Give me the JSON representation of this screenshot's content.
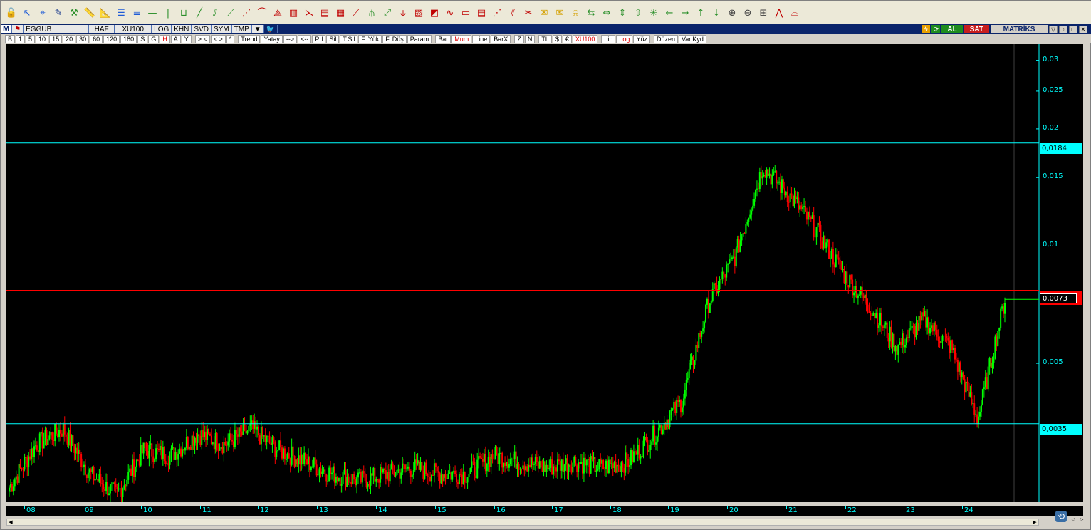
{
  "tools": [
    {
      "name": "lock-icon",
      "glyph": "🔓",
      "color": "#2a8f2a"
    },
    {
      "name": "cursor-arrow-icon",
      "glyph": "↖",
      "color": "#1e5bd6"
    },
    {
      "name": "crosshair-icon",
      "glyph": "⌖",
      "color": "#1e5bd6"
    },
    {
      "name": "pencil-icon",
      "glyph": "✎",
      "color": "#1e3e8f"
    },
    {
      "name": "tools-icon",
      "glyph": "⚒",
      "color": "#2a8f2a"
    },
    {
      "name": "ruler-icon",
      "glyph": "📏",
      "color": "#2a8f2a"
    },
    {
      "name": "ruler-alt-icon",
      "glyph": "📐",
      "color": "#2a8f2a"
    },
    {
      "name": "parallel-lines-icon",
      "glyph": "☰",
      "color": "#1e5bd6"
    },
    {
      "name": "equal-lines-icon",
      "glyph": "≡",
      "color": "#1e5bd6"
    },
    {
      "name": "horizontal-line-icon",
      "glyph": "—",
      "color": "#2a8f2a"
    },
    {
      "name": "vertical-line-icon",
      "glyph": "|",
      "color": "#2a8f2a"
    },
    {
      "name": "channel-icon",
      "glyph": "⊔",
      "color": "#2a8f2a"
    },
    {
      "name": "trend-line-icon",
      "glyph": "╱",
      "color": "#2a8f2a"
    },
    {
      "name": "trend-channel-icon",
      "glyph": "⫽",
      "color": "#2a8f2a"
    },
    {
      "name": "regression-icon",
      "glyph": "⟋",
      "color": "#2a8f2a"
    },
    {
      "name": "fibonacci-fan-icon",
      "glyph": "⋰",
      "color": "#c00000"
    },
    {
      "name": "fibonacci-arc-icon",
      "glyph": "⌒",
      "color": "#c00000"
    },
    {
      "name": "gann-fan-icon",
      "glyph": "⟁",
      "color": "#c00000"
    },
    {
      "name": "bars-pattern-icon",
      "glyph": "▥",
      "color": "#c00000"
    },
    {
      "name": "fan-lines-icon",
      "glyph": "⋋",
      "color": "#c00000"
    },
    {
      "name": "fibonacci-retracement-icon",
      "glyph": "▤",
      "color": "#c00000"
    },
    {
      "name": "fibonacci-extension-icon",
      "glyph": "▦",
      "color": "#c00000"
    },
    {
      "name": "speed-lines-icon",
      "glyph": "⟋",
      "color": "#c00000"
    },
    {
      "name": "andrews-pitchfork-icon",
      "glyph": "⫛",
      "color": "#2a8f2a"
    },
    {
      "name": "diagonal-brush-icon",
      "glyph": "⤢",
      "color": "#2a8f2a"
    },
    {
      "name": "cycle-lines-icon",
      "glyph": "⫝",
      "color": "#c00000"
    },
    {
      "name": "time-zones-icon",
      "glyph": "▧",
      "color": "#c00000"
    },
    {
      "name": "raff-channel-icon",
      "glyph": "◩",
      "color": "#c00000"
    },
    {
      "name": "elliott-wave-icon",
      "glyph": "∿",
      "color": "#c00000"
    },
    {
      "name": "fibonacci-time-icon",
      "glyph": "▭",
      "color": "#c00000"
    },
    {
      "name": "grid-lines-icon",
      "glyph": "▤",
      "color": "#c00000"
    },
    {
      "name": "dashed-line-icon",
      "glyph": "⋰",
      "color": "#c00000"
    },
    {
      "name": "ruler-measure-icon",
      "glyph": "⫽",
      "color": "#c00000"
    },
    {
      "name": "paint-icon",
      "glyph": "✂",
      "color": "#c00000"
    },
    {
      "name": "note-icon",
      "glyph": "✉",
      "color": "#d4a000"
    },
    {
      "name": "callout-icon",
      "glyph": "✉",
      "color": "#d4a000"
    },
    {
      "name": "alarm-bell-icon",
      "glyph": "⍾",
      "color": "#d4a000"
    },
    {
      "name": "zoom-in-horizontal-icon",
      "glyph": "⇆",
      "color": "#2a8f2a"
    },
    {
      "name": "zoom-out-horizontal-icon",
      "glyph": "⇔",
      "color": "#2a8f2a"
    },
    {
      "name": "zoom-in-vertical-icon",
      "glyph": "⇕",
      "color": "#2a8f2a"
    },
    {
      "name": "zoom-out-vertical-icon",
      "glyph": "⇳",
      "color": "#2a8f2a"
    },
    {
      "name": "fit-all-icon",
      "glyph": "✳",
      "color": "#2a8f2a"
    },
    {
      "name": "arrow-left-icon",
      "glyph": "←",
      "color": "#2a8f2a"
    },
    {
      "name": "arrow-right-icon",
      "glyph": "→",
      "color": "#2a8f2a"
    },
    {
      "name": "arrow-up-icon",
      "glyph": "↑",
      "color": "#2a8f2a"
    },
    {
      "name": "arrow-down-icon",
      "glyph": "↓",
      "color": "#2a8f2a"
    },
    {
      "name": "magnifier-add-icon",
      "glyph": "⊕",
      "color": "#404040"
    },
    {
      "name": "magnifier-remove-icon",
      "glyph": "⊖",
      "color": "#404040"
    },
    {
      "name": "chart-settings-icon",
      "glyph": "⊞",
      "color": "#404040"
    },
    {
      "name": "line-chart-icon",
      "glyph": "⋀",
      "color": "#c00000"
    },
    {
      "name": "arc-icon",
      "glyph": "⌓",
      "color": "#c00000"
    }
  ],
  "infobar": {
    "menu": "M",
    "symbol": "EGGUB",
    "period": "HAF",
    "index": "XU100",
    "log": "LOG",
    "khn": "KHN",
    "svd": "SVD",
    "sym": "SYM",
    "tmp": "TMP",
    "buy_label": "AL",
    "sell_label": "SAT",
    "brand": "MATRİKS"
  },
  "optbar": {
    "periods": [
      "B",
      "1",
      "5",
      "10",
      "15",
      "20",
      "30",
      "60",
      "120",
      "180",
      "S",
      "G",
      "H",
      "A",
      "Y"
    ],
    "selected_period": "H",
    "scroll": [
      ">.<",
      "<.>",
      "*"
    ],
    "drawing": [
      "Trend",
      "Yatay",
      "-->",
      "<--",
      "Prl",
      "Sil",
      "T.Sil",
      "F. Yük",
      "F. Düş",
      "Param"
    ],
    "chart_types": [
      "Bar",
      "Mum",
      "Line",
      "BarX"
    ],
    "selected_chart_type": "Mum",
    "scale": [
      "Z",
      "N"
    ],
    "currency": [
      "TL",
      "$",
      "€",
      "XU100"
    ],
    "selected_currency": "XU100",
    "axis": [
      "Lin",
      "Log",
      "Yüz"
    ],
    "selected_axis": "Log",
    "edit": [
      "Düzen",
      "Var.Kyd"
    ]
  },
  "chart_data": {
    "type": "candlestick",
    "symbol": "EGGUB",
    "scale": "log",
    "ylim": [
      0.0022,
      0.033
    ],
    "y_ticks": [
      "0,03",
      "0,025",
      "0,02",
      "0,015",
      "0,01",
      "0,005"
    ],
    "y_tick_values": [
      0.03,
      0.025,
      0.02,
      0.015,
      0.01,
      0.005
    ],
    "x_labels": [
      "08",
      "09",
      "10",
      "11",
      "12",
      "13",
      "14",
      "15",
      "16",
      "17",
      "18",
      "19",
      "20",
      "21",
      "22",
      "23",
      "24"
    ],
    "horizontal_lines": [
      {
        "value": 0.0184,
        "label": "0,0184",
        "color": "#00ffff"
      },
      {
        "value": 0.0035,
        "label": "0,0035",
        "color": "#00ffff"
      },
      {
        "value": 0.0077,
        "label": "",
        "color": "#ff0000"
      }
    ],
    "last_price": {
      "value": 0.0073,
      "label": "0,0073"
    },
    "up_color": "#00ff00",
    "down_color": "#ff0000",
    "price_path": [
      {
        "year": "08",
        "price": 0.0024
      },
      {
        "year": "08",
        "price": 0.0031
      },
      {
        "year": "08",
        "price": 0.0034
      },
      {
        "year": "09",
        "price": 0.0026
      },
      {
        "year": "09",
        "price": 0.0023
      },
      {
        "year": "10",
        "price": 0.003
      },
      {
        "year": "10",
        "price": 0.0029
      },
      {
        "year": "11",
        "price": 0.0033
      },
      {
        "year": "11",
        "price": 0.0031
      },
      {
        "year": "12",
        "price": 0.0034
      },
      {
        "year": "12",
        "price": 0.003
      },
      {
        "year": "13",
        "price": 0.0028
      },
      {
        "year": "13",
        "price": 0.0026
      },
      {
        "year": "14",
        "price": 0.0025
      },
      {
        "year": "14",
        "price": 0.0026
      },
      {
        "year": "15",
        "price": 0.0027
      },
      {
        "year": "15",
        "price": 0.0026
      },
      {
        "year": "16",
        "price": 0.0026
      },
      {
        "year": "16",
        "price": 0.0029
      },
      {
        "year": "17",
        "price": 0.0028
      },
      {
        "year": "17",
        "price": 0.0027
      },
      {
        "year": "18",
        "price": 0.0028
      },
      {
        "year": "18",
        "price": 0.0027
      },
      {
        "year": "19",
        "price": 0.0028
      },
      {
        "year": "19",
        "price": 0.0033
      },
      {
        "year": "20",
        "price": 0.004
      },
      {
        "year": "20",
        "price": 0.0072
      },
      {
        "year": "21",
        "price": 0.0095
      },
      {
        "year": "21",
        "price": 0.016
      },
      {
        "year": "21",
        "price": 0.0135
      },
      {
        "year": "22",
        "price": 0.011
      },
      {
        "year": "22",
        "price": 0.0085
      },
      {
        "year": "23",
        "price": 0.007
      },
      {
        "year": "23",
        "price": 0.0055
      },
      {
        "year": "23",
        "price": 0.0065
      },
      {
        "year": "24",
        "price": 0.0055
      },
      {
        "year": "24",
        "price": 0.0036
      },
      {
        "year": "24",
        "price": 0.0073
      }
    ]
  }
}
